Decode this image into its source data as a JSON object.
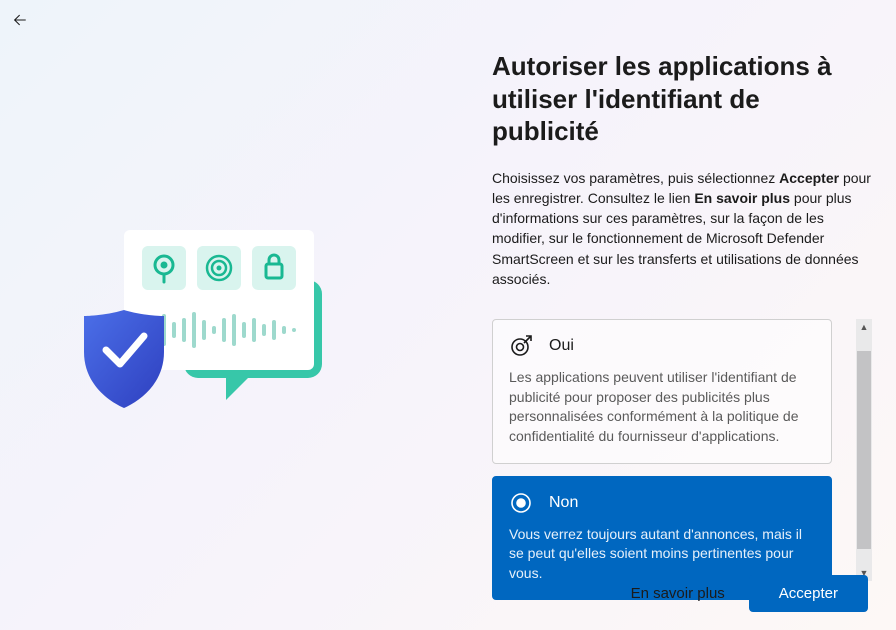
{
  "title": "Autoriser les applications à utiliser l'identifiant de publicité",
  "intro": {
    "pre": "Choisissez vos paramètres, puis sélectionnez ",
    "b1": "Accepter",
    "mid": " pour les enregistrer. Consultez le lien ",
    "b2": "En savoir plus",
    "post": " pour plus d'informations sur ces paramètres, sur la façon de les modifier, sur le fonctionnement de Microsoft Defender SmartScreen et sur les transferts et utilisations de données associés."
  },
  "options": {
    "yes": {
      "label": "Oui",
      "desc": "Les applications peuvent utiliser l'identifiant de publicité pour proposer des publicités plus personnalisées conformément à la politique de confidentialité du fournisseur d'applications."
    },
    "no": {
      "label": "Non",
      "desc": "Vous verrez toujours autant d'annonces, mais il se peut qu'elles soient moins pertinentes pour vous."
    }
  },
  "learn_more": "En savoir plus",
  "accept": "Accepter"
}
